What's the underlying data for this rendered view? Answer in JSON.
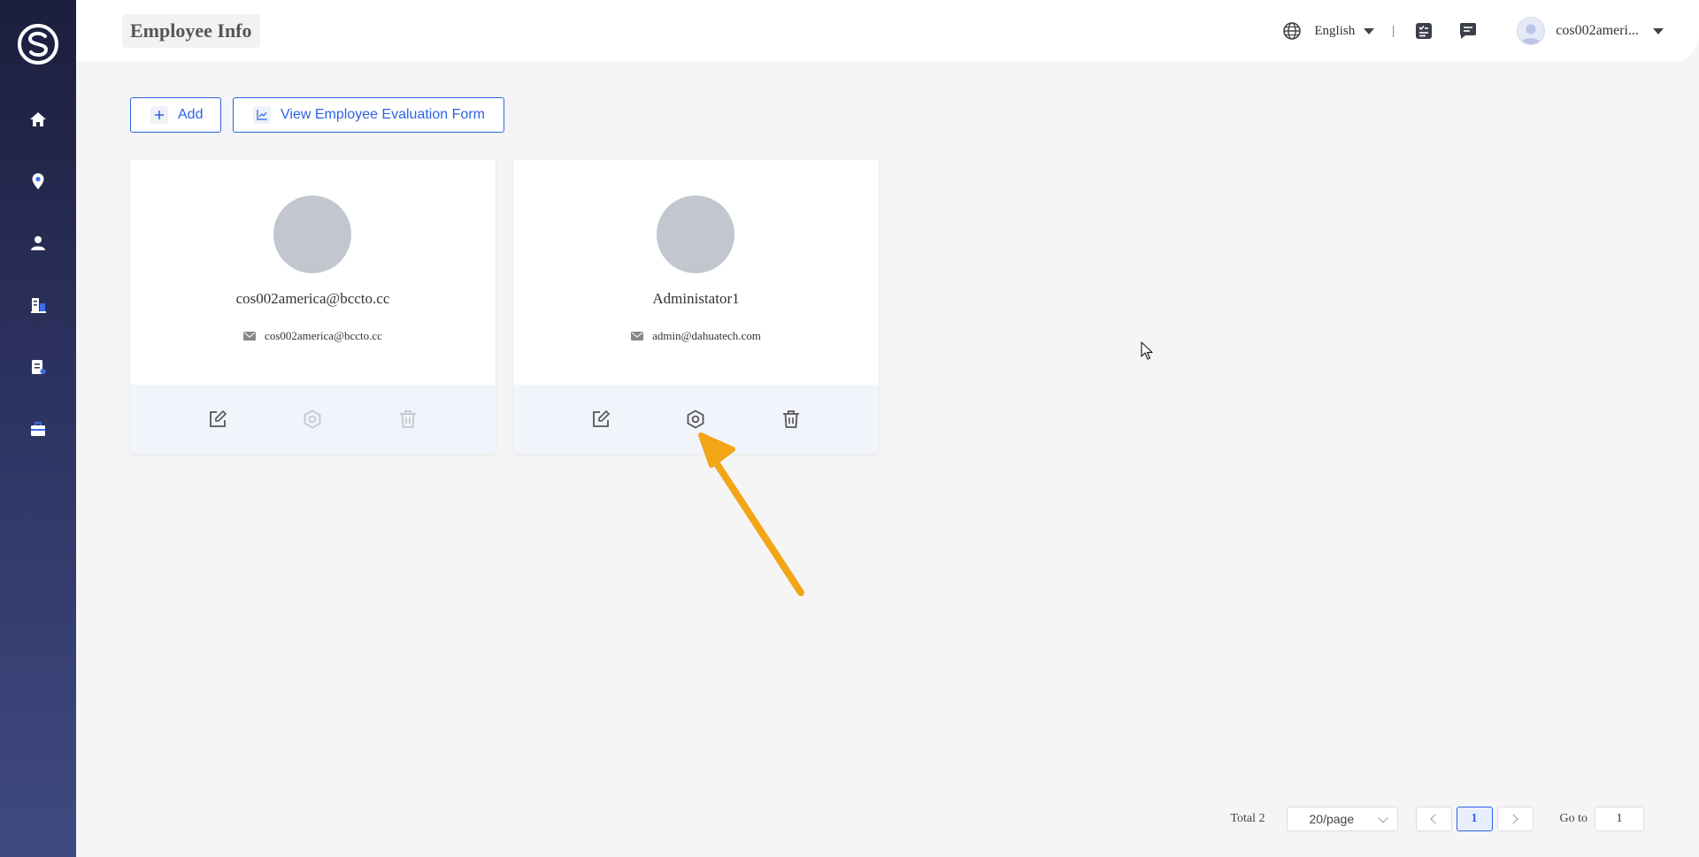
{
  "header": {
    "title": "Employee Info",
    "language": "English",
    "separator": "|",
    "user": "cos002ameri..."
  },
  "toolbar": {
    "add_label": "Add",
    "eval_label": "View Employee Evaluation Form"
  },
  "employees": [
    {
      "name": "cos002america@bccto.cc",
      "email": "cos002america@bccto.cc",
      "settings_enabled": false,
      "delete_enabled": false
    },
    {
      "name": "Administator1",
      "email": "admin@dahuatech.com",
      "settings_enabled": true,
      "delete_enabled": true
    }
  ],
  "pagination": {
    "total": "Total 2",
    "page_size": "20/page",
    "current_page": "1",
    "goto_label": "Go to",
    "goto_value": "1"
  },
  "colors": {
    "accent": "#2b63e6",
    "sidebar_top": "#1c1e3d",
    "sidebar_bottom": "#3f4a82",
    "annotation_arrow": "#f2a516"
  },
  "sidebar": {
    "items": [
      {
        "icon": "home-icon"
      },
      {
        "icon": "location-pin-icon"
      },
      {
        "icon": "user-icon"
      },
      {
        "icon": "building-icon"
      },
      {
        "icon": "report-icon"
      },
      {
        "icon": "toolbox-icon"
      }
    ]
  }
}
